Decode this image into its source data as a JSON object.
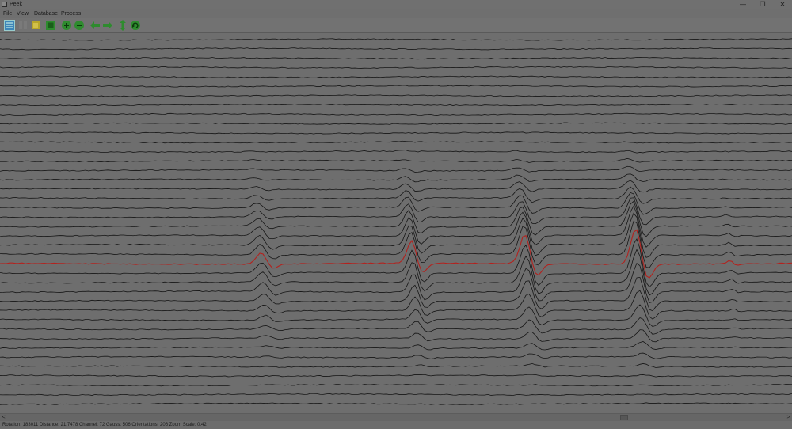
{
  "window": {
    "title": "Peek",
    "controls": {
      "minimize": "—",
      "restore": "❐",
      "close": "✕"
    }
  },
  "menu": [
    {
      "label": "File"
    },
    {
      "label": "View"
    },
    {
      "label": "Database"
    },
    {
      "label": "Process"
    }
  ],
  "toolbar": {
    "buttons": [
      {
        "name": "list-view-icon",
        "color": "#3d86b8"
      },
      {
        "name": "grid-view-icon",
        "color": "#7a7a7a"
      },
      {
        "name": "folder-icon",
        "color": "#b8a62a"
      },
      {
        "name": "stop-icon",
        "color": "#2e8b2e"
      },
      {
        "name": "zoom-in-icon",
        "color": "#2e8b2e"
      },
      {
        "name": "zoom-out-icon",
        "color": "#2e8b2e"
      },
      {
        "name": "arrow-left-icon",
        "color": "#2e8b2e"
      },
      {
        "name": "arrow-right-icon",
        "color": "#2e8b2e"
      },
      {
        "name": "vertical-scale-icon",
        "color": "#2e8b2e"
      },
      {
        "name": "refresh-icon",
        "color": "#2e8b2e"
      }
    ]
  },
  "plot": {
    "trace_color": "#161616",
    "highlight_color": "#b3221e",
    "highlight_trace": 24,
    "trace_count": 40
  },
  "scrollbar": {
    "left_arrow": "<",
    "right_arrow": ">"
  },
  "status": {
    "text": "Rotation: 183011 Distance: 21.7478   Channel: 72   Gauss: 506   Orientations: 206 Zoom Scale: 0.42"
  }
}
